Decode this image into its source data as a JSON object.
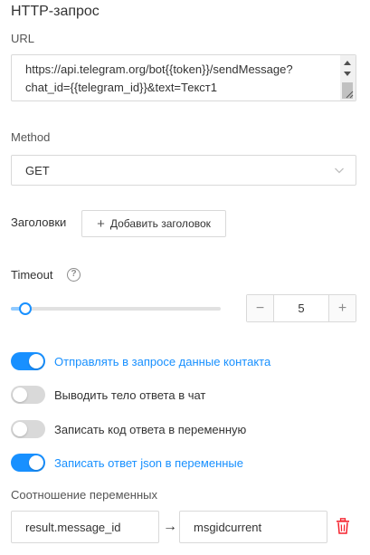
{
  "section_title": "HTTP-запрос",
  "url": {
    "label": "URL",
    "value": "https://api.telegram.org/bot{{token}}/sendMessage?\nchat_id={{telegram_id}}&text=Текст1"
  },
  "method": {
    "label": "Method",
    "selected": "GET"
  },
  "headers": {
    "label": "Заголовки",
    "add_button": "Добавить заголовок"
  },
  "timeout": {
    "label": "Timeout",
    "help_glyph": "?",
    "slider_fraction": 0.07,
    "value": "5",
    "minus_glyph": "−",
    "plus_glyph": "+"
  },
  "toggles": [
    {
      "label": "Отправлять в запросе данные контакта",
      "on": true
    },
    {
      "label": "Выводить тело ответа в чат",
      "on": false
    },
    {
      "label": "Записать код ответа в переменную",
      "on": false
    },
    {
      "label": "Записать ответ json в переменные",
      "on": true
    }
  ],
  "mapping": {
    "label": "Соотношение переменных",
    "source": "result.message_id",
    "arrow": "→",
    "target": "msgidcurrent"
  },
  "colors": {
    "accent": "#1890ff",
    "danger": "#f5222d",
    "border": "#d9d9d9"
  }
}
